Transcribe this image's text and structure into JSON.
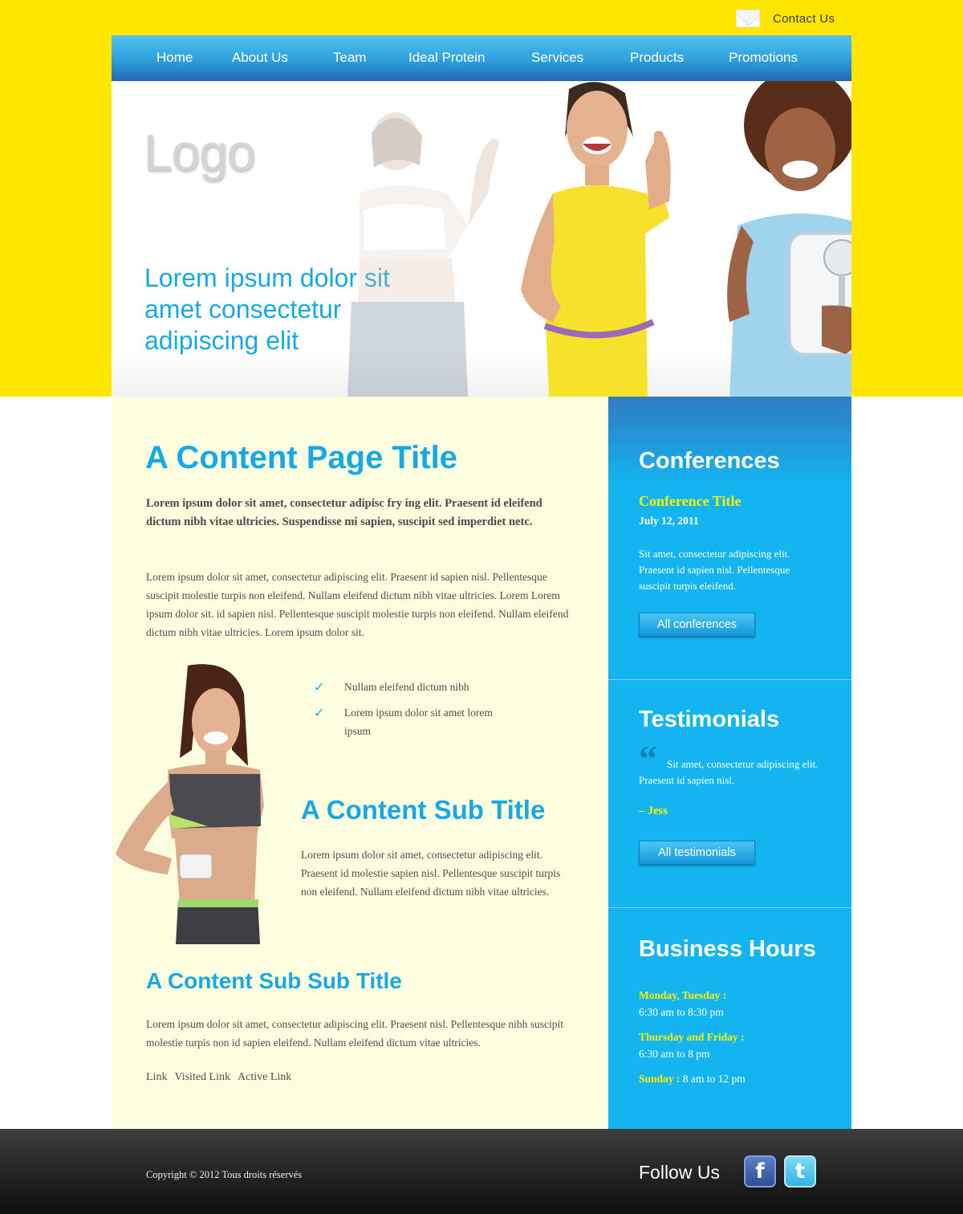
{
  "header": {
    "contact_label": "Contact Us",
    "envelope_icon": "envelope-icon"
  },
  "nav": {
    "items": [
      {
        "label": "Home"
      },
      {
        "label": "About Us"
      },
      {
        "label": "Team"
      },
      {
        "label": "Ideal Protein"
      },
      {
        "label": "Services"
      },
      {
        "label": "Products"
      },
      {
        "label": "Promotions"
      }
    ]
  },
  "hero": {
    "logo": "Logo",
    "tagline": "Lorem ipsum dolor sit amet consectetur adipiscing elit"
  },
  "main": {
    "title": "A Content Page Title",
    "intro": "Lorem ipsum dolor sit amet, consectetur adipisc fry ing elit. Praesent id eleifend dictum nibh vitae ultricies. Suspendisse mi sapien, suscipit sed imperdiet netc.",
    "paragraph": "Lorem ipsum dolor sit amet, consectetur adipiscing elit. Praesent id sapien nisl. Pellentesque suscipit molestie turpis non eleifend. Nullam eleifend dictum nibh vitae ultricies. Lorem Lorem ipsum dolor sit. id sapien nisl. Pellentesque suscipit molestie turpis non eleifend. Nullam eleifend dictum nibh vitae ultricies. Lorem ipsum dolor sit.",
    "checklist": [
      "Nullam eleifend dictum nibh",
      "Lorem ipsum dolor sit amet lorem ipsum"
    ],
    "check_glyph": "✓",
    "sub_title": "A Content Sub Title",
    "sub_paragraph": "Lorem ipsum dolor sit amet, consectetur adipiscing elit. Praesent id molestie sapien nisl. Pellentesque suscipit turpis non eleifend. Nullam eleifend dictum nibh vitae ultricies.",
    "sub_sub_title": "A Content Sub Sub Title",
    "sub_sub_paragraph": "Lorem ipsum dolor sit amet, consectetur adipiscing elit. Praesent nisl. Pellentesque nibh suscipit molestie turpis non  id sapien eleifend. Nullam eleifend dictum vitae ultricies.",
    "links": {
      "link": "Link",
      "visited": "Visited Link",
      "active": "Active Link"
    }
  },
  "sidebar": {
    "conferences": {
      "heading": "Conferences",
      "item_title": "Conference Title",
      "date": "July 12, 2011",
      "text": "Sit amet, consectetur adipiscing elit. Praesent id sapien nisl. Pellentesque suscipit turpis eleifend.",
      "button": "All conferences"
    },
    "testimonials": {
      "heading": "Testimonials",
      "quote_glyph": "“",
      "quote": "Sit amet, consectetur adipiscing elit. Praesent id sapien nisl.",
      "author": "– Jess",
      "button": "All testimonials"
    },
    "hours": {
      "heading": "Business Hours",
      "rows": [
        {
          "days": "Monday, Tuesday :",
          "time": "6:30 am to 8:30 pm"
        },
        {
          "days": "Thursday and Friday :",
          "time": "6:30 am to 8 pm"
        },
        {
          "days": "Sunday :",
          "time": "8 am to 12 pm"
        }
      ]
    }
  },
  "footer": {
    "copyright": "Copyright © 2012 Tous droits réservés",
    "follow": "Follow Us",
    "facebook_glyph": "f",
    "twitter_glyph": "t"
  },
  "colors": {
    "yellow": "#ffe600",
    "accent_blue": "#18a9e5",
    "sidebar_blue": "#14b4f1",
    "highlight_yellow": "#fff200",
    "content_bg": "#fdfee0"
  }
}
